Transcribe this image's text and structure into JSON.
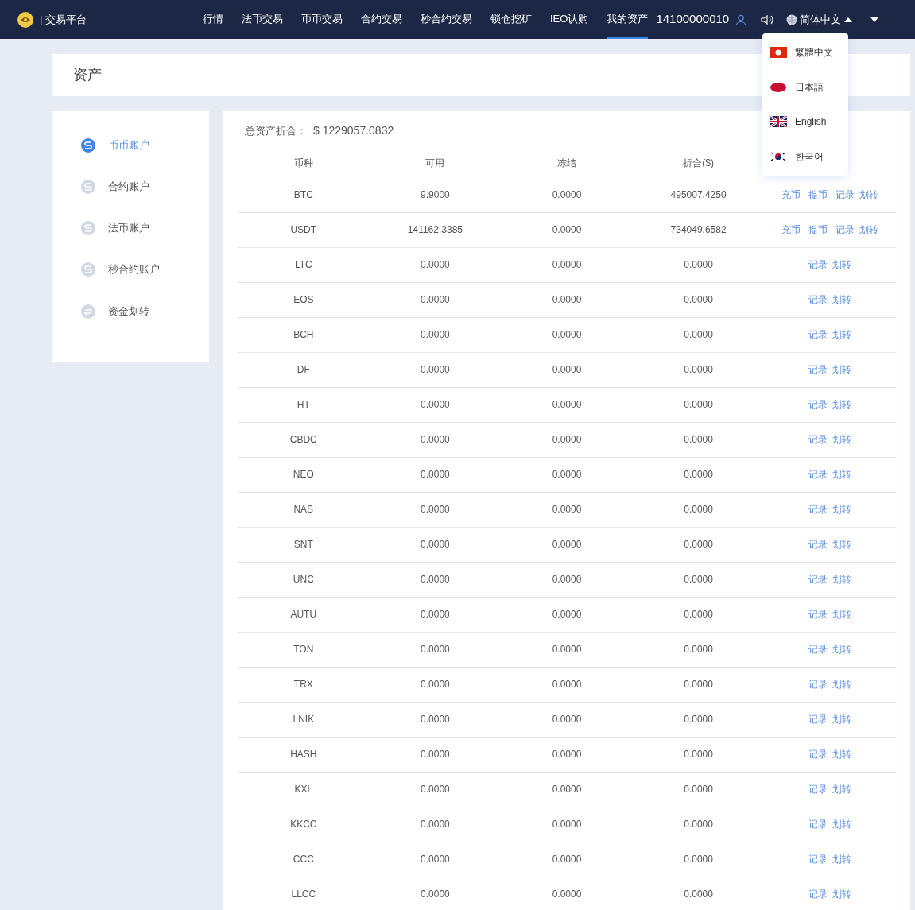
{
  "navbar": {
    "brand": "| 交易平台",
    "menu": [
      {
        "label": "行情",
        "selected": false
      },
      {
        "label": "法币交易",
        "selected": false
      },
      {
        "label": "币币交易",
        "selected": false
      },
      {
        "label": "合约交易",
        "selected": false
      },
      {
        "label": "秒合约交易",
        "selected": false
      },
      {
        "label": "锁仓挖矿",
        "selected": false
      },
      {
        "label": "IEO认购",
        "selected": false
      },
      {
        "label": "我的资产",
        "selected": true
      }
    ],
    "account": "14100000010",
    "language": "简体中文"
  },
  "language_menu": [
    "繁體中文",
    "日本語",
    "English",
    "한국어"
  ],
  "page_title": "资产",
  "sidebar": [
    {
      "label": "币币账户",
      "selected": true
    },
    {
      "label": "合约账户",
      "selected": false
    },
    {
      "label": "法币账户",
      "selected": false
    },
    {
      "label": "秒合约账户",
      "selected": false
    },
    {
      "label": "资金划转",
      "selected": false
    }
  ],
  "total": {
    "label": "总资产折合：",
    "value": "$ 1229057.0832"
  },
  "table": {
    "columns": [
      "币种",
      "可用",
      "冻结",
      "折合($)"
    ],
    "rows": [
      {
        "cells": [
          "BTC",
          "9.9000",
          "0.0000",
          "495007.4250"
        ],
        "actions": [
          "充币",
          "提币",
          "记录",
          "划转"
        ]
      },
      {
        "cells": [
          "USDT",
          "141162.3385",
          "0.0000",
          "734049.6582"
        ],
        "actions": [
          "充币",
          "提币",
          "记录",
          "划转"
        ]
      },
      {
        "cells": [
          "LTC",
          "0.0000",
          "0.0000",
          "0.0000"
        ],
        "actions": [
          "记录",
          "划转"
        ]
      },
      {
        "cells": [
          "EOS",
          "0.0000",
          "0.0000",
          "0.0000"
        ],
        "actions": [
          "记录",
          "划转"
        ]
      },
      {
        "cells": [
          "BCH",
          "0.0000",
          "0.0000",
          "0.0000"
        ],
        "actions": [
          "记录",
          "划转"
        ]
      },
      {
        "cells": [
          "DF",
          "0.0000",
          "0.0000",
          "0.0000"
        ],
        "actions": [
          "记录",
          "划转"
        ]
      },
      {
        "cells": [
          "HT",
          "0.0000",
          "0.0000",
          "0.0000"
        ],
        "actions": [
          "记录",
          "划转"
        ]
      },
      {
        "cells": [
          "CBDC",
          "0.0000",
          "0.0000",
          "0.0000"
        ],
        "actions": [
          "记录",
          "划转"
        ]
      },
      {
        "cells": [
          "NEO",
          "0.0000",
          "0.0000",
          "0.0000"
        ],
        "actions": [
          "记录",
          "划转"
        ]
      },
      {
        "cells": [
          "NAS",
          "0.0000",
          "0.0000",
          "0.0000"
        ],
        "actions": [
          "记录",
          "划转"
        ]
      },
      {
        "cells": [
          "SNT",
          "0.0000",
          "0.0000",
          "0.0000"
        ],
        "actions": [
          "记录",
          "划转"
        ]
      },
      {
        "cells": [
          "UNC",
          "0.0000",
          "0.0000",
          "0.0000"
        ],
        "actions": [
          "记录",
          "划转"
        ]
      },
      {
        "cells": [
          "AUTU",
          "0.0000",
          "0.0000",
          "0.0000"
        ],
        "actions": [
          "记录",
          "划转"
        ]
      },
      {
        "cells": [
          "TON",
          "0.0000",
          "0.0000",
          "0.0000"
        ],
        "actions": [
          "记录",
          "划转"
        ]
      },
      {
        "cells": [
          "TRX",
          "0.0000",
          "0.0000",
          "0.0000"
        ],
        "actions": [
          "记录",
          "划转"
        ]
      },
      {
        "cells": [
          "LNIK",
          "0.0000",
          "0.0000",
          "0.0000"
        ],
        "actions": [
          "记录",
          "划转"
        ]
      },
      {
        "cells": [
          "HASH",
          "0.0000",
          "0.0000",
          "0.0000"
        ],
        "actions": [
          "记录",
          "划转"
        ]
      },
      {
        "cells": [
          "KXL",
          "0.0000",
          "0.0000",
          "0.0000"
        ],
        "actions": [
          "记录",
          "划转"
        ]
      },
      {
        "cells": [
          "KKCC",
          "0.0000",
          "0.0000",
          "0.0000"
        ],
        "actions": [
          "记录",
          "划转"
        ]
      },
      {
        "cells": [
          "CCC",
          "0.0000",
          "0.0000",
          "0.0000"
        ],
        "actions": [
          "记录",
          "划转"
        ]
      },
      {
        "cells": [
          "LLCC",
          "0.0000",
          "0.0000",
          "0.0000"
        ],
        "actions": [
          "记录",
          "划转"
        ]
      }
    ]
  }
}
